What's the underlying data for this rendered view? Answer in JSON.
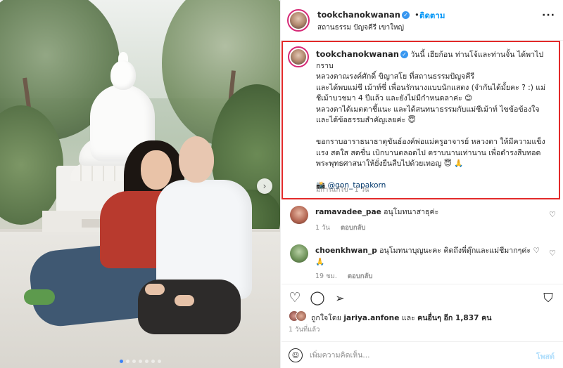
{
  "post": {
    "header": {
      "username": "tookchanokwanan",
      "verified_glyph": "✓",
      "follow_label": "ติดตาม",
      "separator": "•",
      "location": "สถานธรรม ปัญจคีรี เขาใหญ่",
      "more_icon": "more-horizontal-icon",
      "more_glyph": "···"
    },
    "caption": {
      "username": "tookchanokwanan",
      "lines_block1": [
        "วันนี้ เฮียก้อน ท่านโจ้และท่านจั้น ได้พาไปกราบ",
        "หลวงตาณรงค์ศักดิ์ ขิญาสโย ที่สถานธรรมปัญจคีรี",
        "และได้พบแม่ชี เม้าท์ซี่ เพื่อนรักนางแบบนักแสดง (จำกันได้มั้ยคะ ? :) แม่",
        "ชีเม้าบวชมา 4 ปีแล้ว และยังไม่มีกำหนดลาค่ะ 😊",
        "หลวงตาได้เมตตาชี้แนะ และได้สนทนาธรรมกับแม่ชีเม้าท์ ไขข้อข้องใจ",
        "และได้ข้อธรรมสำคัญเลยค่ะ 😇"
      ],
      "lines_block2": [
        "ขอกราบอาราธนาธาตุขันธ์องค์พ่อแม่ครูอาจารย์ หลวงตา ให้มีความแข็ง",
        "แรง สดใส สดชื่น เบิกบานตลอดไป ตราบนานเท่านาน เพื่อดำรงสืบทอด",
        "พระพุทธศาสนาให้ยั่งยืนสืบไปด้วยเทอญ 😇 🙏"
      ],
      "mention_prefix": "📸",
      "mention": "@gon_tapakorn",
      "meta": "มีการแก้ไข · 1 วัน"
    },
    "comments": [
      {
        "username": "ramavadee_pae",
        "text": "อนุโมทนาสาธุค่ะ",
        "time": "1 วัน",
        "reply_label": "ตอบกลับ",
        "like_glyph": "♡"
      },
      {
        "username": "choenkhwan_p",
        "text": "อนุโมทนาบุญนะคะ คิดถึงพี่ตุ๊กและแม่ชีมากๆค่ะ ♡",
        "text_line2": "🙏",
        "time": "19 ชม.",
        "reply_label": "ตอบกลับ",
        "like_glyph": "♡"
      }
    ],
    "actions": {
      "like_glyph": "♡",
      "comment_glyph": "◯",
      "share_glyph": "➢",
      "save_glyph": "⛉"
    },
    "likes": {
      "prefix": "ถูกใจโดย",
      "user": "jariya.anfone",
      "mid": "และ",
      "others": "คนอื่นๆ อีก 1,837 คน"
    },
    "date": "1 วันที่แล้ว",
    "add_comment": {
      "emoji_glyph": "☺",
      "placeholder": "เพิ่มความคิดเห็น...",
      "post_label": "โพสต์"
    },
    "carousel": {
      "next_glyph": "›",
      "dots_count": 7,
      "active_index": 0
    }
  }
}
